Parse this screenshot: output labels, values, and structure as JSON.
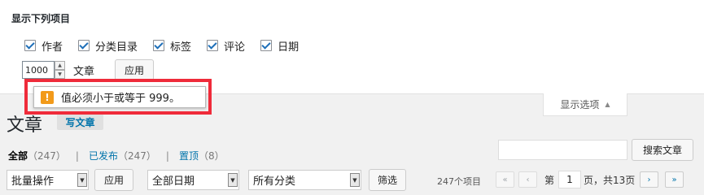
{
  "screen_options": {
    "title": "显示下列项目",
    "columns": [
      {
        "label": "作者",
        "checked": true
      },
      {
        "label": "分类目录",
        "checked": true
      },
      {
        "label": "标签",
        "checked": true
      },
      {
        "label": "评论",
        "checked": true
      },
      {
        "label": "日期",
        "checked": true
      }
    ],
    "per_page_value": "1000",
    "per_page_suffix": "文章",
    "apply_label": "应用",
    "tab_label": "显示选项"
  },
  "validation_tooltip": {
    "icon": "warning-icon",
    "icon_glyph": "!",
    "message": "值必须小于或等于 999。"
  },
  "colors": {
    "highlight": "#ef2b3a",
    "link": "#0073aa",
    "warning": "#f29a1a"
  },
  "page": {
    "title": "文章",
    "add_new": "写文章"
  },
  "filters": {
    "all": {
      "label": "全部",
      "count": "（247）"
    },
    "published": {
      "label": "已发布",
      "count": "（247）"
    },
    "sticky": {
      "label": "置顶",
      "count": "（8）"
    },
    "separator": "|"
  },
  "search": {
    "value": "",
    "button": "搜索文章"
  },
  "tablenav": {
    "bulk_action": "批量操作",
    "apply": "应用",
    "dates": "全部日期",
    "categories": "所有分类",
    "filter": "筛选",
    "items_count": "247个项目",
    "first_page": "«",
    "prev_page": "‹",
    "next_page": "›",
    "last_page": "»",
    "page_prefix": "第",
    "current_page": "1",
    "page_suffix": "页，共13页"
  }
}
